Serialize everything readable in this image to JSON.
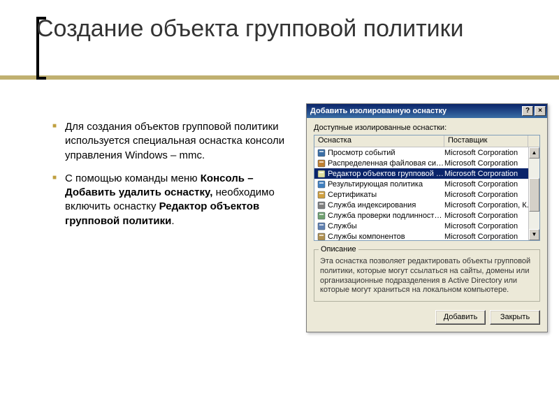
{
  "slide": {
    "title": "Создание объекта групповой политики",
    "bullets": [
      {
        "pre": "Для создания объектов групповой политики используется специальная оснастка консоли управления Windows – mmc.",
        "bold1": "",
        "mid": "",
        "bold2": "",
        "post": ""
      },
      {
        "pre": "С помощью команды меню ",
        "bold1": "Консоль – Добавить удалить оснастку,",
        "mid": " необходимо включить оснастку ",
        "bold2": "Редактор объектов групповой политики",
        "post": "."
      }
    ]
  },
  "dialog": {
    "title": "Добавить изолированную оснастку",
    "help": "?",
    "close": "×",
    "label_available": "Доступные изолированные оснастки:",
    "columns": {
      "snapin": "Оснастка",
      "vendor": "Поставщик"
    },
    "rows": [
      {
        "icon": "eventviewer",
        "name": "Просмотр событий",
        "vendor": "Microsoft Corporation",
        "selected": false
      },
      {
        "icon": "dfs",
        "name": "Распределенная файловая систем...",
        "vendor": "Microsoft Corporation",
        "selected": false
      },
      {
        "icon": "gpo",
        "name": "Редактор объектов групповой поли...",
        "vendor": "Microsoft Corporation",
        "selected": true
      },
      {
        "icon": "rsop",
        "name": "Результирующая политика",
        "vendor": "Microsoft Corporation",
        "selected": false
      },
      {
        "icon": "cert",
        "name": "Сертификаты",
        "vendor": "Microsoft Corporation",
        "selected": false
      },
      {
        "icon": "index",
        "name": "Служба индексирования",
        "vendor": "Microsoft Corporation, К...",
        "selected": false
      },
      {
        "icon": "auth",
        "name": "Служба проверки подлинности в И...",
        "vendor": "Microsoft Corporation",
        "selected": false
      },
      {
        "icon": "services",
        "name": "Службы",
        "vendor": "Microsoft Corporation",
        "selected": false
      },
      {
        "icon": "component",
        "name": "Службы компонентов",
        "vendor": "Microsoft Corporation",
        "selected": false
      }
    ],
    "group_legend": "Описание",
    "description": "Эта оснастка позволяет редактировать объекты групповой политики, которые могут ссылаться на сайты, домены или организационные подразделения в Active Directory или которые могут храниться на локальном компьютере.",
    "btn_add": "Добавить",
    "btn_close": "Закрыть"
  },
  "icons": {
    "eventviewer": "#3a6ea5",
    "dfs": "#c08030",
    "gpo": "#e0e0a0",
    "rsop": "#4080c0",
    "cert": "#d0a040",
    "index": "#808080",
    "auth": "#70a070",
    "services": "#6080b0",
    "component": "#b09050"
  }
}
